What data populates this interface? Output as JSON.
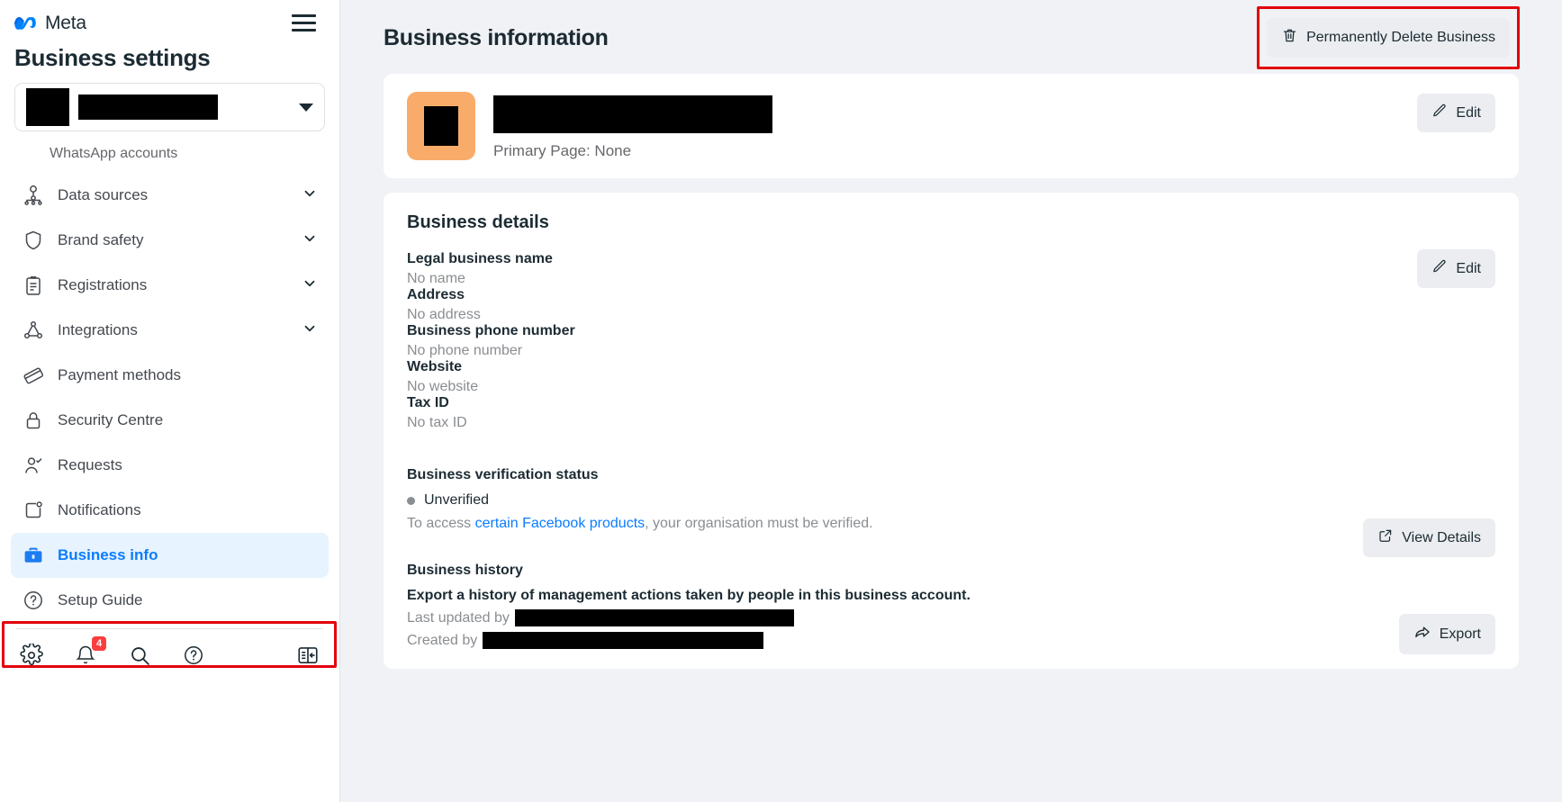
{
  "sidebar": {
    "brand": {
      "name": "Meta",
      "logo_icon": "meta-infinity-logo"
    },
    "menu_icon": "hamburger-menu-icon",
    "title": "Business settings",
    "business_selector": {
      "thumbnail": "redacted-business-thumbnail",
      "name": "",
      "caret_icon": "chevron-down-icon"
    },
    "subheading": "WhatsApp accounts",
    "items": [
      {
        "label": "Data sources",
        "icon": "data-sources-icon",
        "expandable": true
      },
      {
        "label": "Brand safety",
        "icon": "shield-icon",
        "expandable": true
      },
      {
        "label": "Registrations",
        "icon": "clipboard-icon",
        "expandable": true
      },
      {
        "label": "Integrations",
        "icon": "integrations-icon",
        "expandable": true
      },
      {
        "label": "Payment methods",
        "icon": "credit-card-icon",
        "expandable": false
      },
      {
        "label": "Security Centre",
        "icon": "lock-icon",
        "expandable": false
      },
      {
        "label": "Requests",
        "icon": "user-check-icon",
        "expandable": false
      },
      {
        "label": "Notifications",
        "icon": "notification-box-icon",
        "expandable": false
      },
      {
        "label": "Business info",
        "icon": "briefcase-icon",
        "expandable": false,
        "active": true
      },
      {
        "label": "Setup Guide",
        "icon": "question-circle-icon",
        "expandable": false
      }
    ],
    "toolbar": [
      {
        "name": "settings",
        "icon": "gear-icon"
      },
      {
        "name": "notifications",
        "icon": "bell-icon",
        "badge": "4"
      },
      {
        "name": "search",
        "icon": "search-icon"
      },
      {
        "name": "help",
        "icon": "question-circle-icon"
      },
      {
        "name": "collapse-panel",
        "icon": "panel-collapse-icon"
      }
    ]
  },
  "main": {
    "title": "Business information",
    "delete_button": {
      "label": "Permanently Delete Business",
      "icon": "trash-icon"
    },
    "profile": {
      "avatar_color": "#f9ac6a",
      "business_name": "",
      "primary_page": "Primary Page: None",
      "edit_label": "Edit",
      "edit_icon": "pencil-icon"
    },
    "details": {
      "title": "Business details",
      "edit_label": "Edit",
      "edit_icon": "pencil-icon",
      "fields": [
        {
          "label": "Legal business name",
          "value": "No name"
        },
        {
          "label": "Address",
          "value": "No address"
        },
        {
          "label": "Business phone number",
          "value": "No phone number"
        },
        {
          "label": "Website",
          "value": "No website"
        },
        {
          "label": "Tax ID",
          "value": "No tax ID"
        }
      ],
      "verification": {
        "heading": "Business verification status",
        "status": "Unverified",
        "status_dot_color": "#8a8d91",
        "note_prefix": "To access ",
        "note_link": "certain Facebook products",
        "note_suffix": ", your organisation must be verified.",
        "button_label": "View Details",
        "button_icon": "external-link-icon"
      },
      "history": {
        "heading": "Business history",
        "description": "Export a history of management actions taken by people in this business account.",
        "last_updated_label": "Last updated by",
        "created_label": "Created by",
        "button_label": "Export",
        "button_icon": "share-arrow-icon"
      }
    }
  },
  "annotations": {
    "highlight_color": "#e3020b",
    "boxes": [
      "delete-business-button",
      "sidebar-business-info"
    ]
  }
}
